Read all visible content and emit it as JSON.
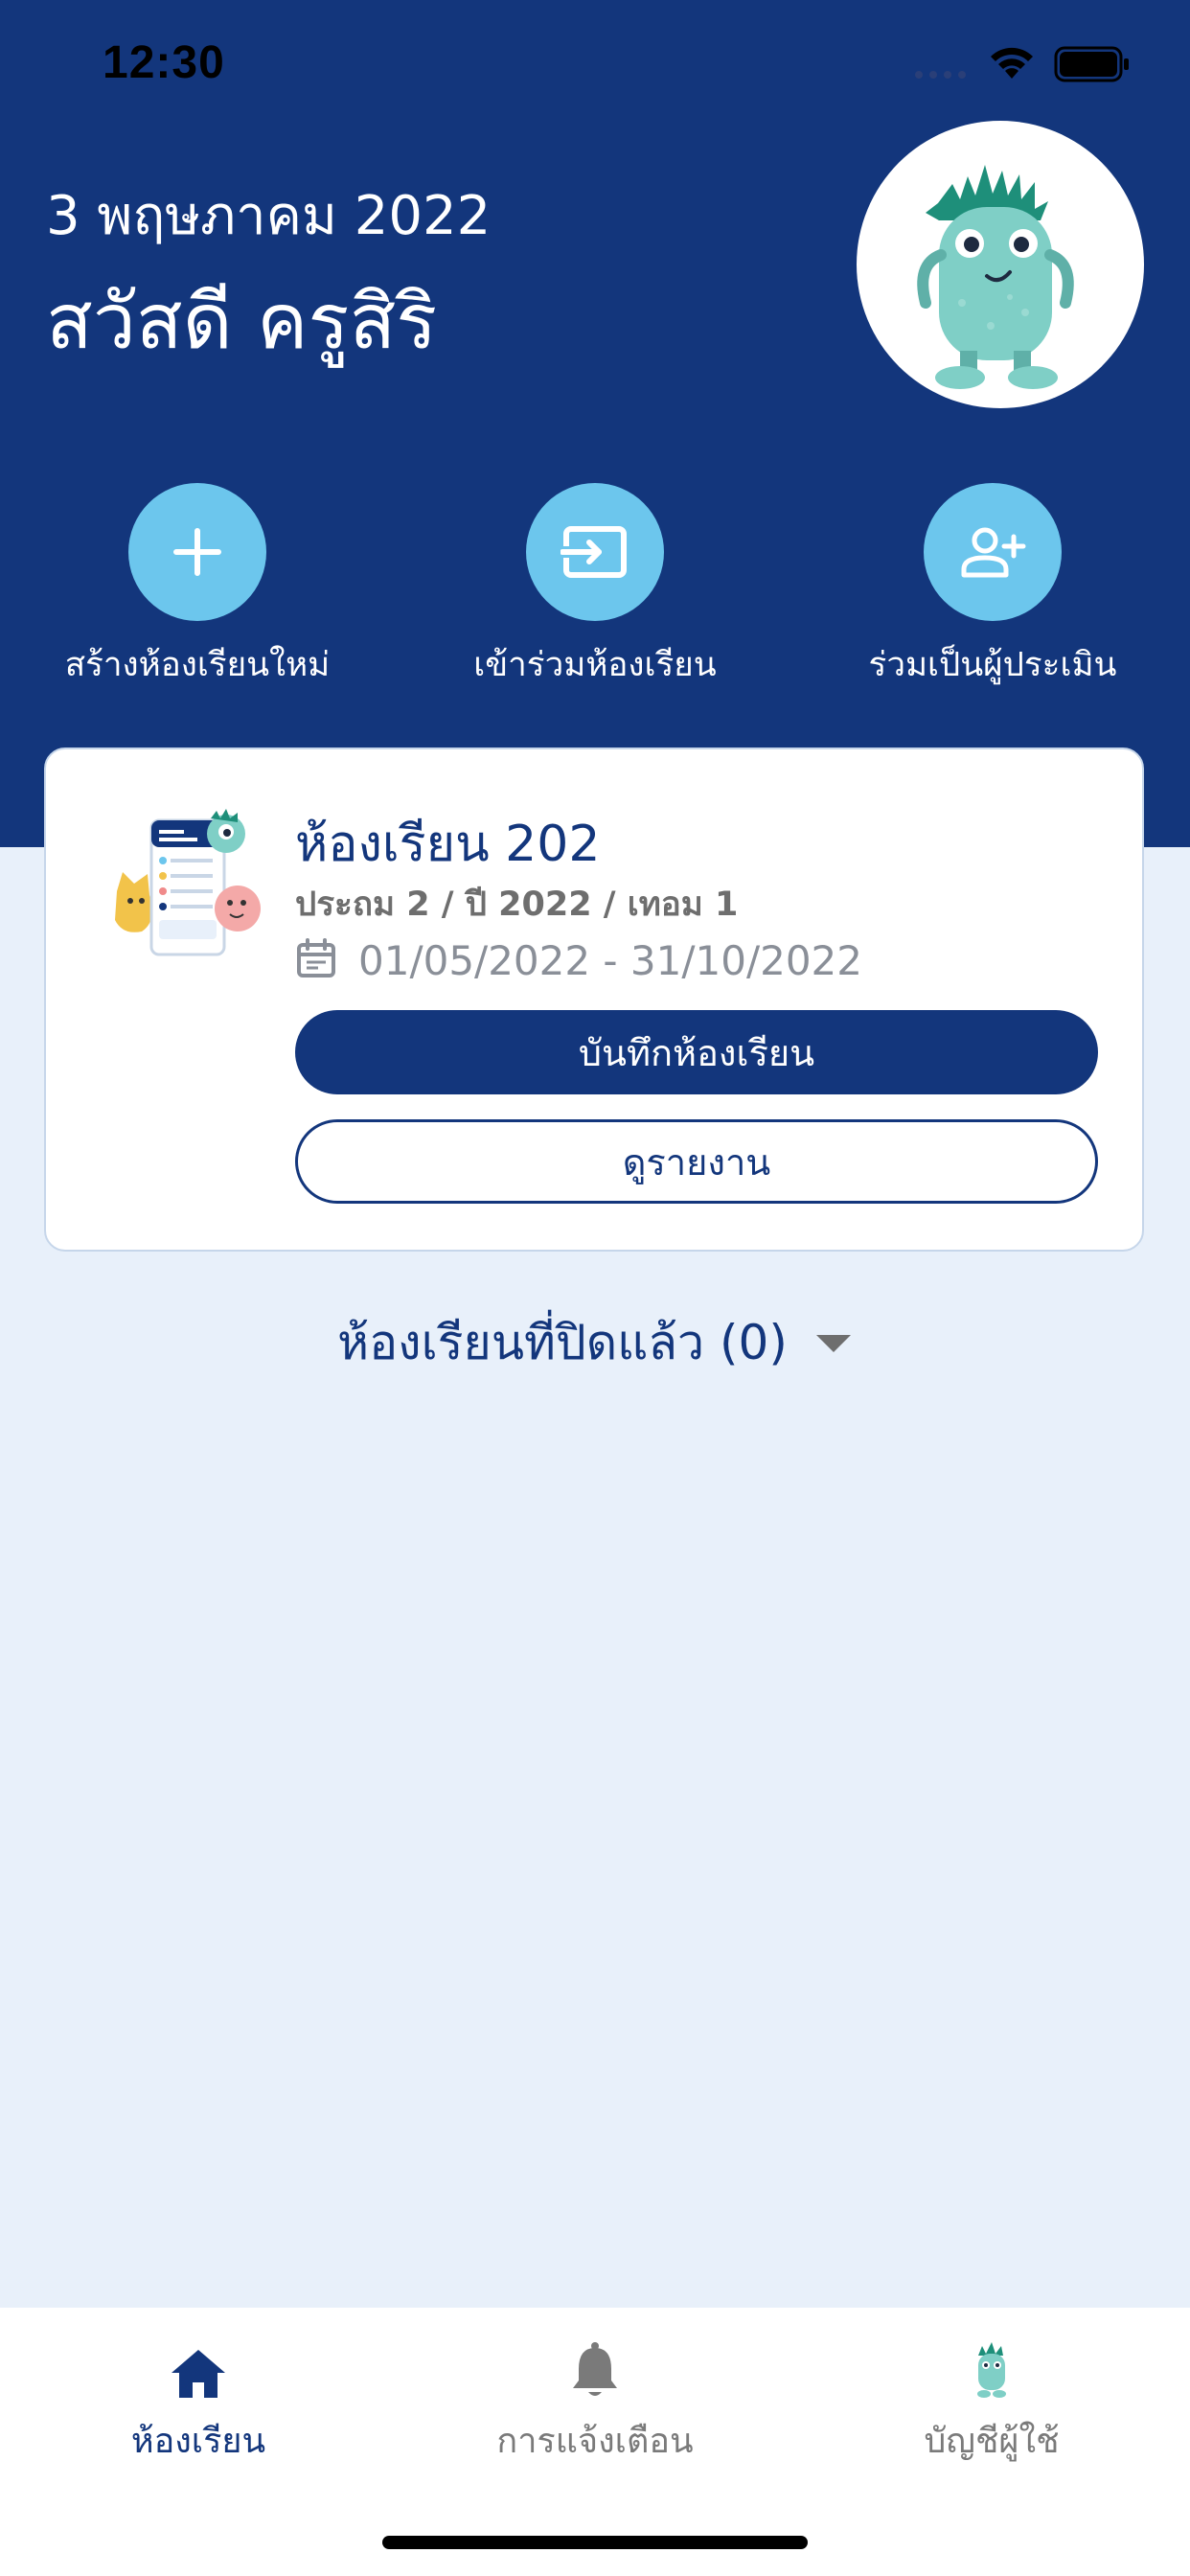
{
  "status_bar": {
    "time": "12:30"
  },
  "header": {
    "date": "3 พฤษภาคม 2022",
    "greeting": "สวัสดี ครูสิริ"
  },
  "quick_actions": [
    {
      "label": "สร้างห้องเรียนใหม่",
      "icon": "plus-icon"
    },
    {
      "label": "เข้าร่วมห้องเรียน",
      "icon": "join-enter-icon"
    },
    {
      "label": "ร่วมเป็นผู้ประเมิน",
      "icon": "add-person-icon"
    }
  ],
  "classroom_card": {
    "name": "ห้องเรียน 202",
    "meta": "ประถม 2 / ปี 2022 / เทอม 1",
    "period": "01/05/2022 - 31/10/2022",
    "primary_button": "บันทึกห้องเรียน",
    "secondary_button": "ดูรายงาน"
  },
  "closed_classrooms": {
    "label": "ห้องเรียนที่ปิดแล้ว (0)"
  },
  "tab_bar": {
    "tabs": [
      {
        "label": "ห้องเรียน",
        "icon": "home-icon",
        "active": true
      },
      {
        "label": "การแจ้งเตือน",
        "icon": "bell-icon",
        "active": false
      },
      {
        "label": "บัญชีผู้ใช้",
        "icon": "monster-avatar-icon",
        "active": false
      }
    ]
  },
  "colors": {
    "header_bg": "#13367c",
    "page_bg": "#e8f0fa",
    "accent_light_blue": "#6cc6ed",
    "active_tab": "#13367c",
    "inactive_tab": "#7a7a7a"
  }
}
